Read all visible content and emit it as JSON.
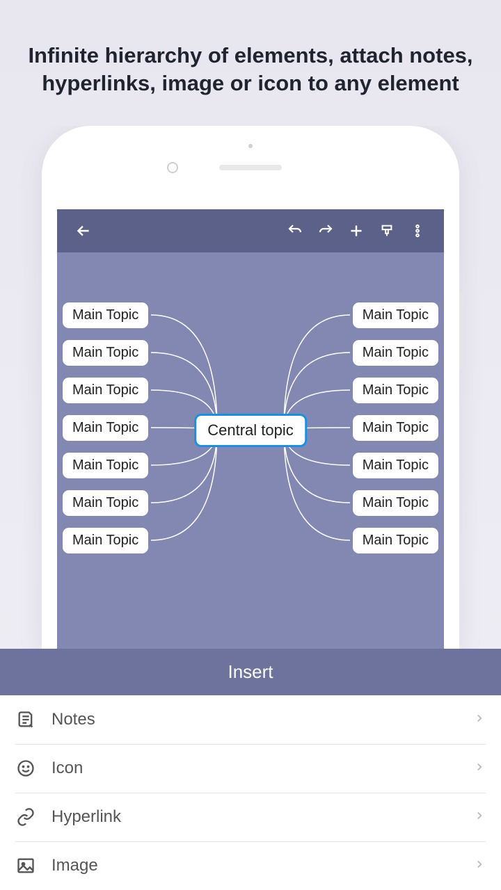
{
  "headline": "Infinite hierarchy of elements, attach notes, hyperlinks, image or icon to any element",
  "mindmap": {
    "central": "Central topic",
    "left": [
      "Main Topic",
      "Main Topic",
      "Main Topic",
      "Main Topic",
      "Main Topic",
      "Main Topic",
      "Main Topic"
    ],
    "right": [
      "Main Topic",
      "Main Topic",
      "Main Topic",
      "Main Topic",
      "Main Topic",
      "Main Topic",
      "Main Topic"
    ]
  },
  "insertHeader": "Insert",
  "menu": [
    {
      "icon": "notes-icon",
      "label": "Notes"
    },
    {
      "icon": "icon-icon",
      "label": "Icon"
    },
    {
      "icon": "hyperlink-icon",
      "label": "Hyperlink"
    },
    {
      "icon": "image-icon",
      "label": "Image"
    }
  ]
}
